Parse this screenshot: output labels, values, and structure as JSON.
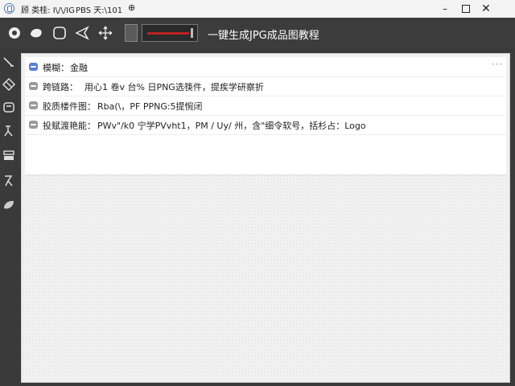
{
  "window": {
    "title_parts": [
      "顾 类桂: I\\/\\/IG",
      "PBS 天:\\101",
      "⊕"
    ],
    "controls": {
      "minimize": "–",
      "close": "✕"
    }
  },
  "toolbar": {
    "title": "一键生成JPG成品图教程",
    "tools": [
      "fill-bucket-icon",
      "lasso-icon",
      "rounded-rect-icon",
      "pen-icon",
      "move-icon"
    ]
  },
  "side_tools": [
    "brush-icon",
    "eraser-icon",
    "stamp-icon",
    "smudge-icon",
    "layer-icon",
    "burn-icon",
    "sponge-icon"
  ],
  "rows": [
    {
      "label": "模糊：",
      "value": "金融",
      "accent": "#5b7fd4"
    },
    {
      "label": "跨链路：",
      "value": "用心1 卷v 台% 日PNG选筷件，提疾学研察折"
    },
    {
      "label": "胶质楼件图：",
      "value": "Rba(\\，PF PPNG:5提惋闭"
    },
    {
      "label": "投赋渡艳能：",
      "value": "PWv\"/k0 宁学PVvht1，PM / Uy/ 州，含\"细令软号，括杉占：Logo"
    }
  ],
  "menu": {
    "more": "···"
  }
}
